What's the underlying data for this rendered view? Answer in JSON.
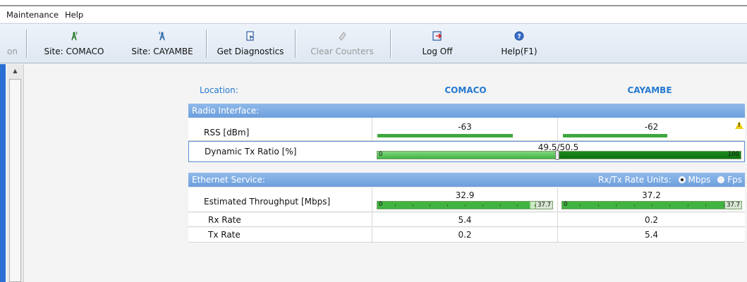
{
  "menu": [
    "Maintenance",
    "Help"
  ],
  "toolbar": {
    "partial_label": "on",
    "buttons": [
      {
        "label": "Site: COMACO",
        "icon": "site-antenna-icon",
        "enabled": true
      },
      {
        "label": "Site: CAYAMBE",
        "icon": "site-antenna-icon",
        "enabled": true
      },
      {
        "label": "Get Diagnostics",
        "icon": "diagnostics-icon",
        "enabled": true
      },
      {
        "label": "Clear Counters",
        "icon": "eraser-icon",
        "enabled": false
      },
      {
        "label": "Log Off",
        "icon": "logoff-icon",
        "enabled": true
      },
      {
        "label": "Help(F1)",
        "icon": "help-icon",
        "enabled": true
      }
    ]
  },
  "location": {
    "label": "Location:",
    "site_a": "COMACO",
    "site_b": "CAYAMBE"
  },
  "radio_interface": {
    "title": "Radio Interface:",
    "rss": {
      "label": "RSS [dBm]",
      "site_a": "-63",
      "site_b": "-62",
      "warning": "!"
    },
    "dynamic_tx": {
      "label": "Dynamic Tx Ratio [%]",
      "value": "49.5/50.5",
      "ratio": 49.5,
      "min": "0",
      "max": "100"
    }
  },
  "ethernet_service": {
    "title": "Ethernet Service:",
    "units_label": "Rx/Tx Rate Units:",
    "units_options": [
      "Mbps",
      "Fps"
    ],
    "units_selected": "Mbps",
    "throughput": {
      "label": "Estimated Throughput [Mbps]",
      "site_a": "32.9",
      "site_a_max": "37.7",
      "site_a_level": 0.873,
      "site_b": "37.2",
      "site_b_max": "37.7",
      "site_b_level": 0.987,
      "min": "0"
    },
    "rx_rate": {
      "label": "Rx Rate",
      "site_a": "5.4",
      "site_b": "0.2"
    },
    "tx_rate": {
      "label": "Tx Rate",
      "site_a": "0.2",
      "site_b": "5.4"
    }
  },
  "colors": {
    "accent": "#2579d0",
    "header": "#7aaae2",
    "bar": "#41b341",
    "bar_dark": "#0f6e0f",
    "warning": "#f2d21b"
  }
}
